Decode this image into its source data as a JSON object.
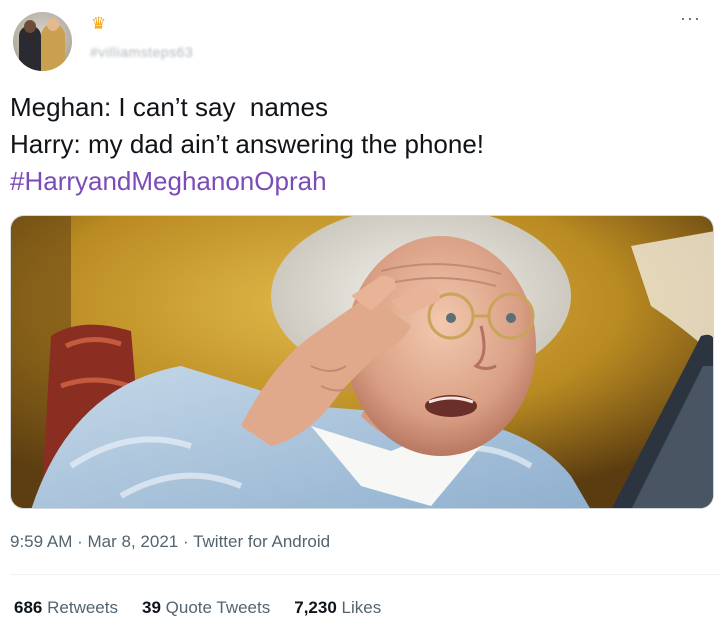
{
  "author": {
    "handle": "#villiamsteps63",
    "badge_icon": "crown-icon"
  },
  "tweet": {
    "lines": [
      "Meghan: I can’t say  names",
      "Harry: my dad ain’t answering the phone!"
    ],
    "hashtag": "#HarryandMeghanonOprah",
    "hashtag_color": "#7b4bb7"
  },
  "more_label": "···",
  "meta": {
    "time": "9:59 AM",
    "date": "Mar 8, 2021",
    "source": "Twitter for Android",
    "separator": "·"
  },
  "stats": {
    "retweets_count": "686",
    "retweets_label": "Retweets",
    "quotes_count": "39",
    "quotes_label": "Quote Tweets",
    "likes_count": "7,230",
    "likes_label": "Likes"
  }
}
